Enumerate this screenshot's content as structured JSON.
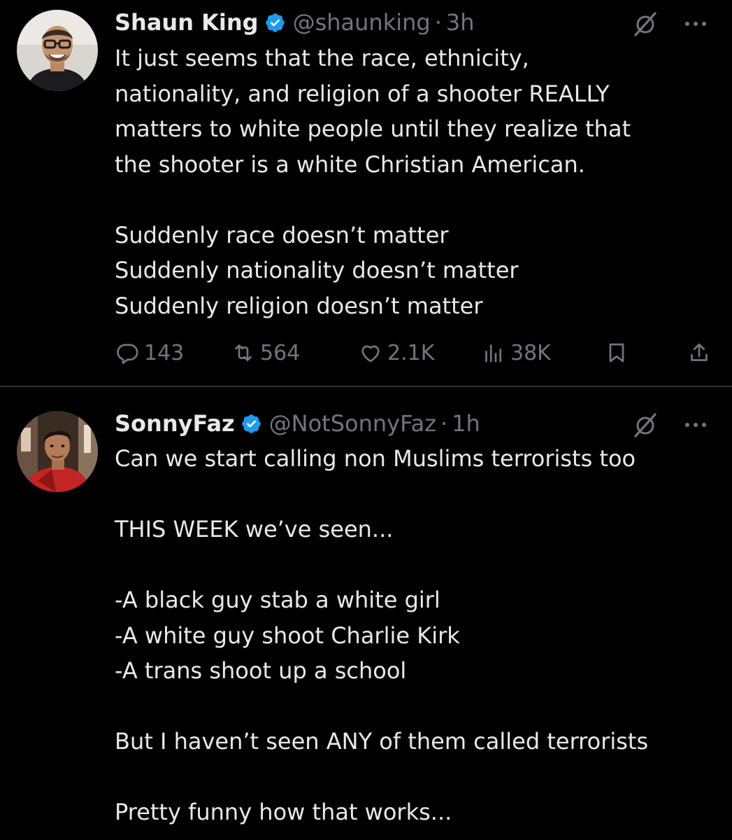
{
  "tweets": [
    {
      "name": "Shaun King",
      "handle": "@shaunking",
      "separator": "·",
      "time": "3h",
      "lines": [
        "It just seems that the race, ethnicity,",
        "nationality, and religion of a shooter REALLY",
        "matters to white people until they realize that",
        "the shooter is a white Christian American.",
        "",
        "Suddenly race doesn’t matter",
        "Suddenly nationality doesn’t matter",
        "Suddenly religion doesn’t matter"
      ],
      "stats": {
        "replies": "143",
        "reposts": "564",
        "likes": "2.1K",
        "views": "38K"
      }
    },
    {
      "name": "SonnyFaz",
      "handle": "@NotSonnyFaz",
      "separator": "·",
      "time": "1h",
      "lines": [
        "Can we start calling non Muslims terrorists too",
        "",
        "THIS WEEK we’ve seen...",
        "",
        "-A black guy stab a white girl",
        "-A white guy shoot Charlie Kirk",
        "-A trans shoot up a school",
        "",
        "But I haven’t seen ANY of them called terrorists",
        "",
        "Pretty funny how that works..."
      ]
    }
  ],
  "colors": {
    "background": "#000000",
    "text": "#e7e9ea",
    "secondary": "#71767b",
    "verified": "#1d9bf0",
    "divider": "#2f3336"
  },
  "icons": {
    "verified": "verified-badge-icon",
    "grok": "grok-icon",
    "more": "more-options-icon",
    "reply": "reply-icon",
    "repost": "repost-icon",
    "like": "like-icon",
    "views": "views-icon",
    "bookmark": "bookmark-icon",
    "share": "share-icon"
  }
}
